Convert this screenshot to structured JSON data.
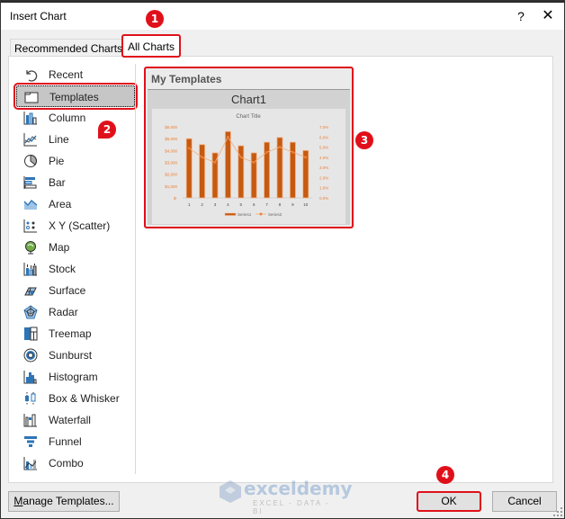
{
  "window": {
    "title": "Insert Chart",
    "help_label": "?",
    "close_label": "✕"
  },
  "tabs": [
    {
      "label": "Recommended Charts",
      "selected": false
    },
    {
      "label": "All Charts",
      "selected": true
    }
  ],
  "sidebar": {
    "items": [
      {
        "label": "Recent",
        "icon": "recent-icon"
      },
      {
        "label": "Templates",
        "icon": "templates-folder-icon",
        "selected": true
      },
      {
        "label": "Column",
        "icon": "column-chart-icon"
      },
      {
        "label": "Line",
        "icon": "line-chart-icon"
      },
      {
        "label": "Pie",
        "icon": "pie-chart-icon"
      },
      {
        "label": "Bar",
        "icon": "bar-chart-icon"
      },
      {
        "label": "Area",
        "icon": "area-chart-icon"
      },
      {
        "label": "X Y (Scatter)",
        "icon": "scatter-chart-icon"
      },
      {
        "label": "Map",
        "icon": "map-chart-icon"
      },
      {
        "label": "Stock",
        "icon": "stock-chart-icon"
      },
      {
        "label": "Surface",
        "icon": "surface-chart-icon"
      },
      {
        "label": "Radar",
        "icon": "radar-chart-icon"
      },
      {
        "label": "Treemap",
        "icon": "treemap-chart-icon"
      },
      {
        "label": "Sunburst",
        "icon": "sunburst-chart-icon"
      },
      {
        "label": "Histogram",
        "icon": "histogram-chart-icon"
      },
      {
        "label": "Box & Whisker",
        "icon": "box-whisker-chart-icon"
      },
      {
        "label": "Waterfall",
        "icon": "waterfall-chart-icon"
      },
      {
        "label": "Funnel",
        "icon": "funnel-chart-icon"
      },
      {
        "label": "Combo",
        "icon": "combo-chart-icon"
      }
    ]
  },
  "templates": {
    "header": "My Templates",
    "items": [
      {
        "name": "Chart1"
      }
    ]
  },
  "chart_data": {
    "type": "bar",
    "title": "Chart Title",
    "categories": [
      "1",
      "2",
      "3",
      "4",
      "5",
      "6",
      "7",
      "8",
      "9",
      "10"
    ],
    "series": [
      {
        "name": "Series1",
        "kind": "bar",
        "axis": "left",
        "values": [
          5000,
          4500,
          3800,
          5600,
          4400,
          3800,
          4700,
          5100,
          4700,
          4000
        ]
      },
      {
        "name": "Series2",
        "kind": "line",
        "axis": "right",
        "values": [
          4.9,
          4.0,
          3.5,
          6.0,
          4.0,
          3.5,
          4.5,
          5.0,
          4.5,
          4.0
        ]
      }
    ],
    "y_left": {
      "range": [
        0,
        6000
      ],
      "ticks": [
        "$-",
        "$1,000",
        "$2,000",
        "$3,000",
        "$4,000",
        "$5,000",
        "$6,000"
      ]
    },
    "y_right": {
      "range": [
        0,
        7
      ],
      "ticks": [
        "0.0%",
        "1.0%",
        "2.0%",
        "3.0%",
        "4.0%",
        "5.0%",
        "6.0%",
        "7.0%"
      ]
    },
    "legend": "bottom",
    "colors": {
      "bar": "#c55a11",
      "bar_edge": "#f4b183",
      "line": "#f4b183",
      "marker": "#ed7d31",
      "tick": "#ed7d31"
    }
  },
  "buttons": {
    "manage_prefix": "M",
    "manage_rest": "anage Templates...",
    "ok": "OK",
    "cancel": "Cancel"
  },
  "annotations": [
    "1",
    "2",
    "3",
    "4"
  ],
  "watermark": {
    "brand": "exceldemy",
    "tagline": "EXCEL - DATA - BI"
  },
  "colors": {
    "accent_red": "#e0101a",
    "selected_bg": "#c6c6c6"
  }
}
